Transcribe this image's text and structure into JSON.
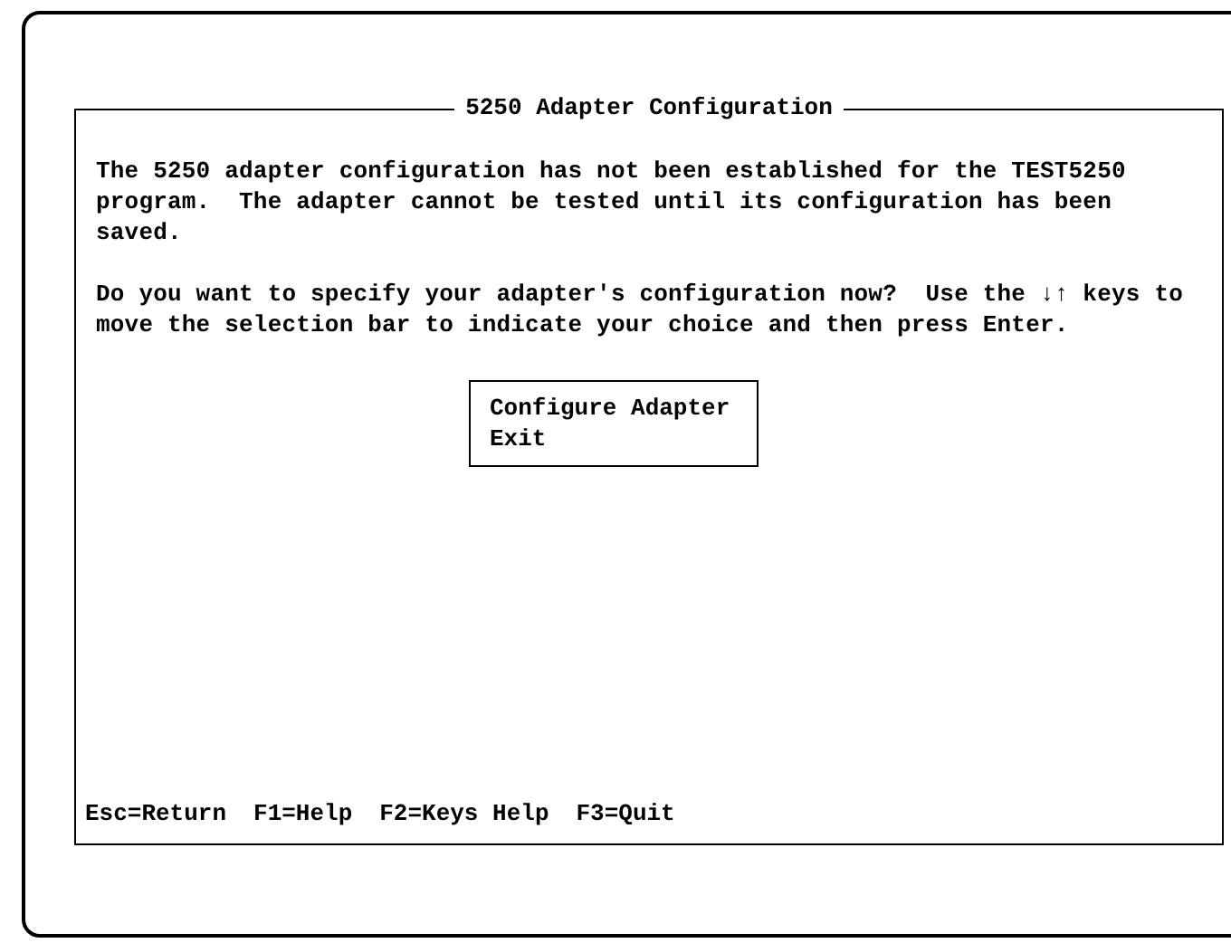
{
  "panel": {
    "title": "5250 Adapter Configuration"
  },
  "message": [
    "The 5250 adapter configuration has not been established for the TEST5250 program.  The adapter cannot be tested until its configuration has been saved.",
    "Do you want to specify your adapter's configuration now?  Use the ↓↑ keys to move the selection bar to indicate your choice and then press Enter."
  ],
  "menu": [
    "Configure Adapter",
    "Exit"
  ],
  "function_keys": [
    "Esc=Return",
    "F1=Help",
    "F2=Keys Help",
    "F3=Quit"
  ]
}
